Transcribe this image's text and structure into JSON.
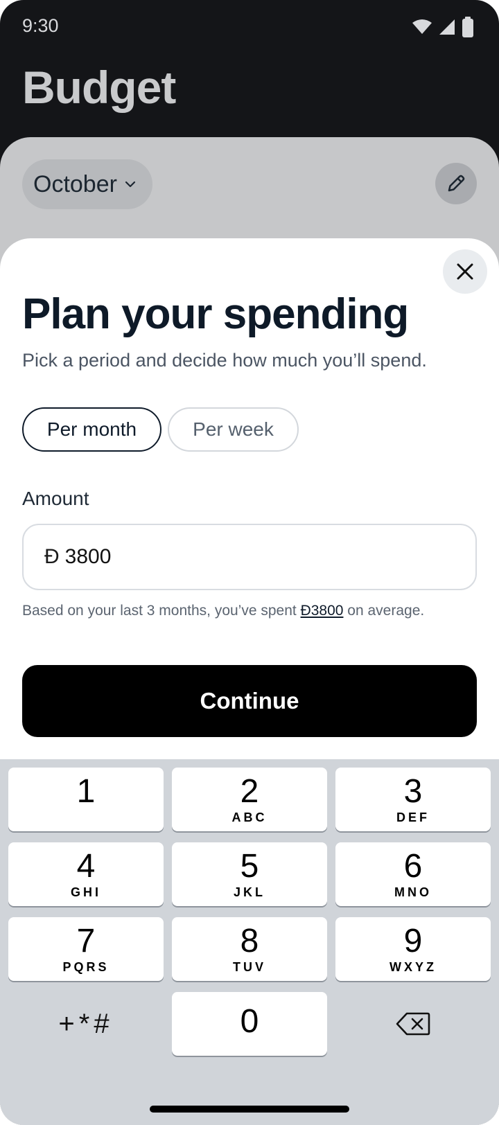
{
  "status_bar": {
    "time": "9:30",
    "icons": [
      "wifi-icon",
      "signal-icon",
      "battery-icon"
    ]
  },
  "app": {
    "title": "Budget"
  },
  "background": {
    "month": "October"
  },
  "sheet": {
    "title": "Plan your spending",
    "subtitle": "Pick a period and decide how much you’ll spend.",
    "period_options": [
      "Per month",
      "Per week"
    ],
    "selected_period": "Per month",
    "amount_label": "Amount",
    "currency_symbol": "Đ",
    "amount_value": "3800",
    "hint_prefix": "Based on your last 3 months, you’ve spent ",
    "hint_amount": "Đ3800",
    "hint_suffix": " on average.",
    "continue_label": "Continue"
  },
  "keyboard": {
    "keys": [
      {
        "digit": "1",
        "letters": ""
      },
      {
        "digit": "2",
        "letters": "ABC"
      },
      {
        "digit": "3",
        "letters": "DEF"
      },
      {
        "digit": "4",
        "letters": "GHI"
      },
      {
        "digit": "5",
        "letters": "JKL"
      },
      {
        "digit": "6",
        "letters": "MNO"
      },
      {
        "digit": "7",
        "letters": "PQRS"
      },
      {
        "digit": "8",
        "letters": "TUV"
      },
      {
        "digit": "9",
        "letters": "WXYZ"
      },
      {
        "digit": "0",
        "letters": ""
      }
    ],
    "symbols": "+*#"
  },
  "colors": {
    "primary": "#0f1b2a",
    "button": "#000000",
    "dim_overlay": "#c6c7c9"
  }
}
